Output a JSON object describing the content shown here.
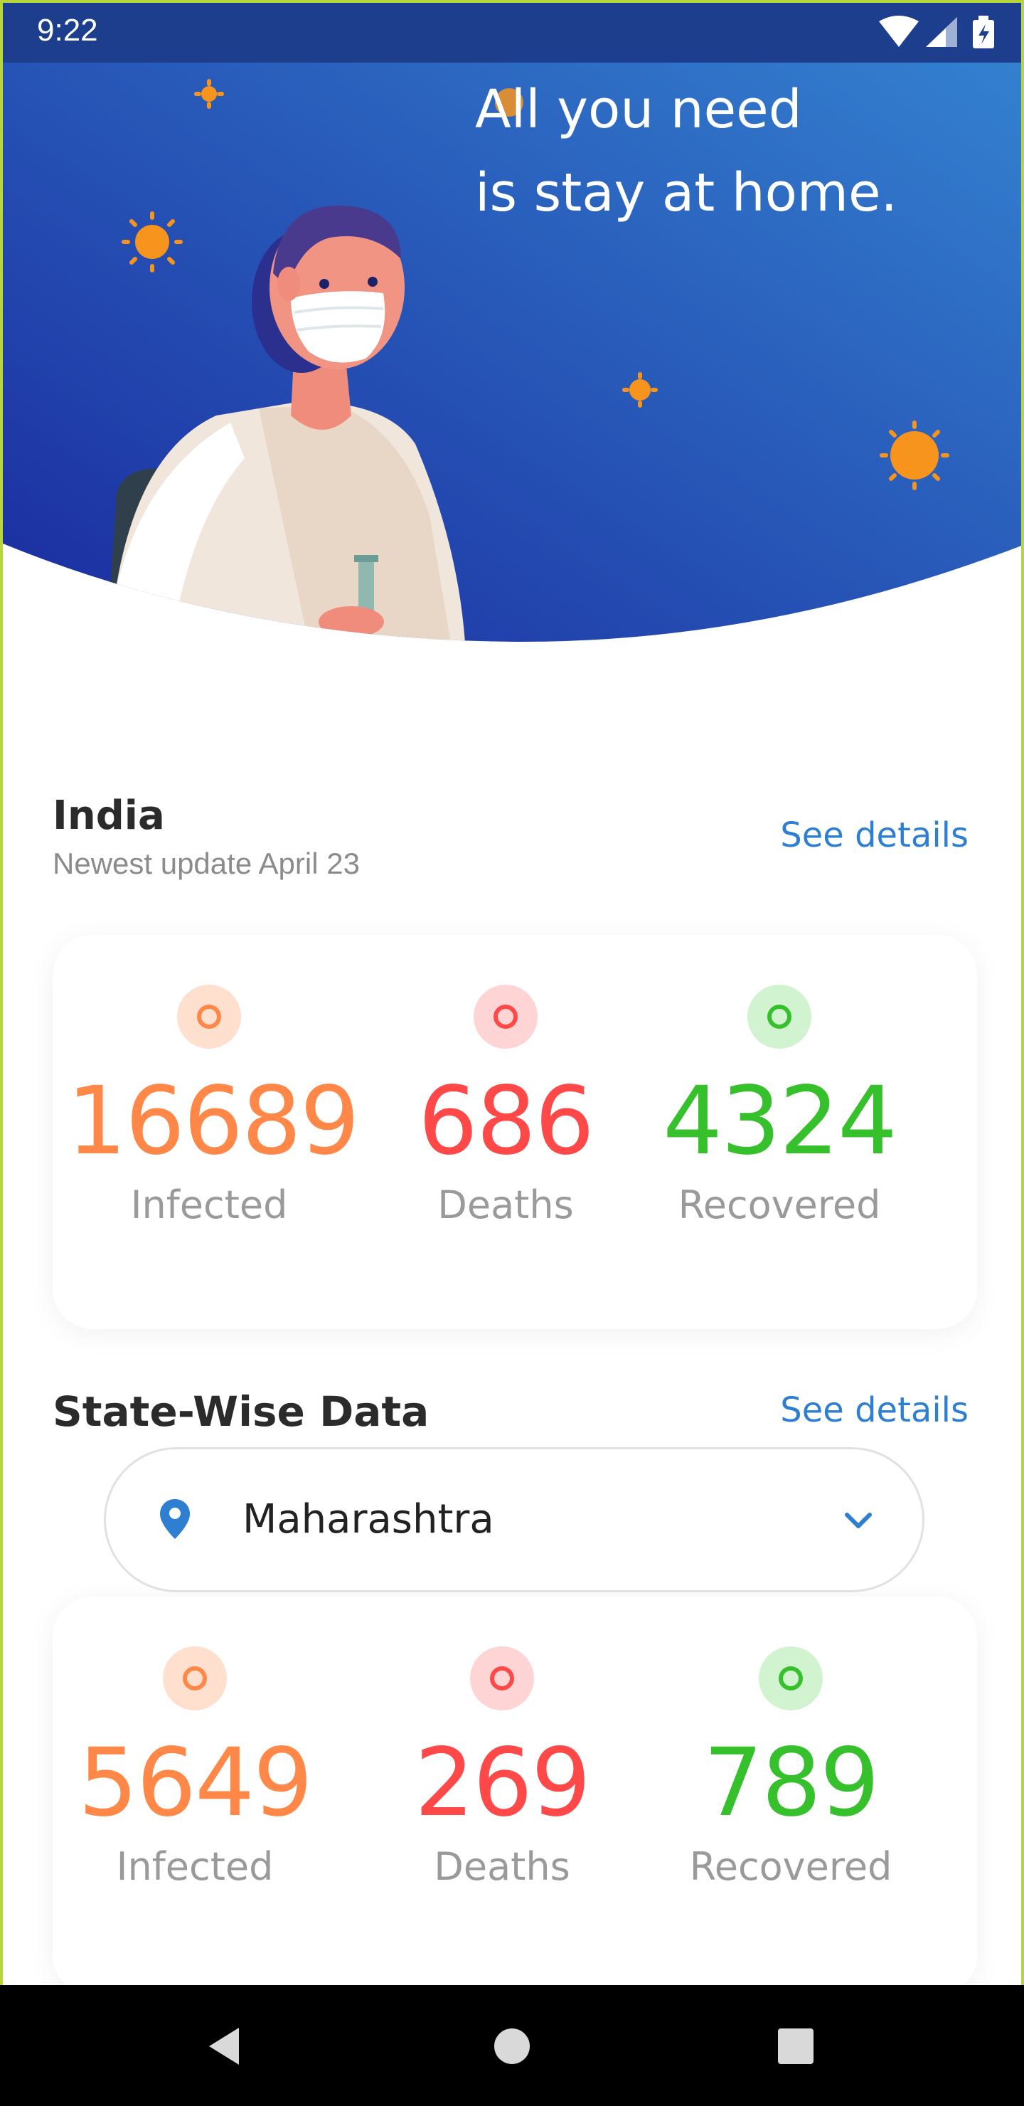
{
  "status_bar": {
    "time": "9:22"
  },
  "hero": {
    "line1": "All you need",
    "line2": "is stay at home."
  },
  "country": {
    "title": "India",
    "subtitle": "Newest update April 23",
    "see_details": "See details",
    "stats": [
      {
        "value": "16689",
        "label": "Infected",
        "color": "#ff8748"
      },
      {
        "value": "686",
        "label": "Deaths",
        "color": "#ff4848"
      },
      {
        "value": "4324",
        "label": "Recovered",
        "color": "#36c12c"
      }
    ]
  },
  "state": {
    "title": "State-Wise Data",
    "see_details": "See details",
    "selected_state": "Maharashtra",
    "stats": [
      {
        "value": "5649",
        "label": "Infected",
        "color": "#ff8748"
      },
      {
        "value": "269",
        "label": "Deaths",
        "color": "#ff4848"
      },
      {
        "value": "789",
        "label": "Recovered",
        "color": "#36c12c"
      }
    ]
  },
  "colors": {
    "hero_gradient_start": "#1a2fa0",
    "hero_gradient_end": "#3381d0",
    "accent": "#2e7fd1",
    "infected": "#ff8748",
    "deaths": "#ff4848",
    "recovered": "#36c12c"
  },
  "icons": [
    "wifi-icon",
    "signal-icon",
    "battery-icon",
    "location-pin-icon",
    "chevron-down-icon",
    "back-icon",
    "home-icon",
    "recents-icon"
  ]
}
